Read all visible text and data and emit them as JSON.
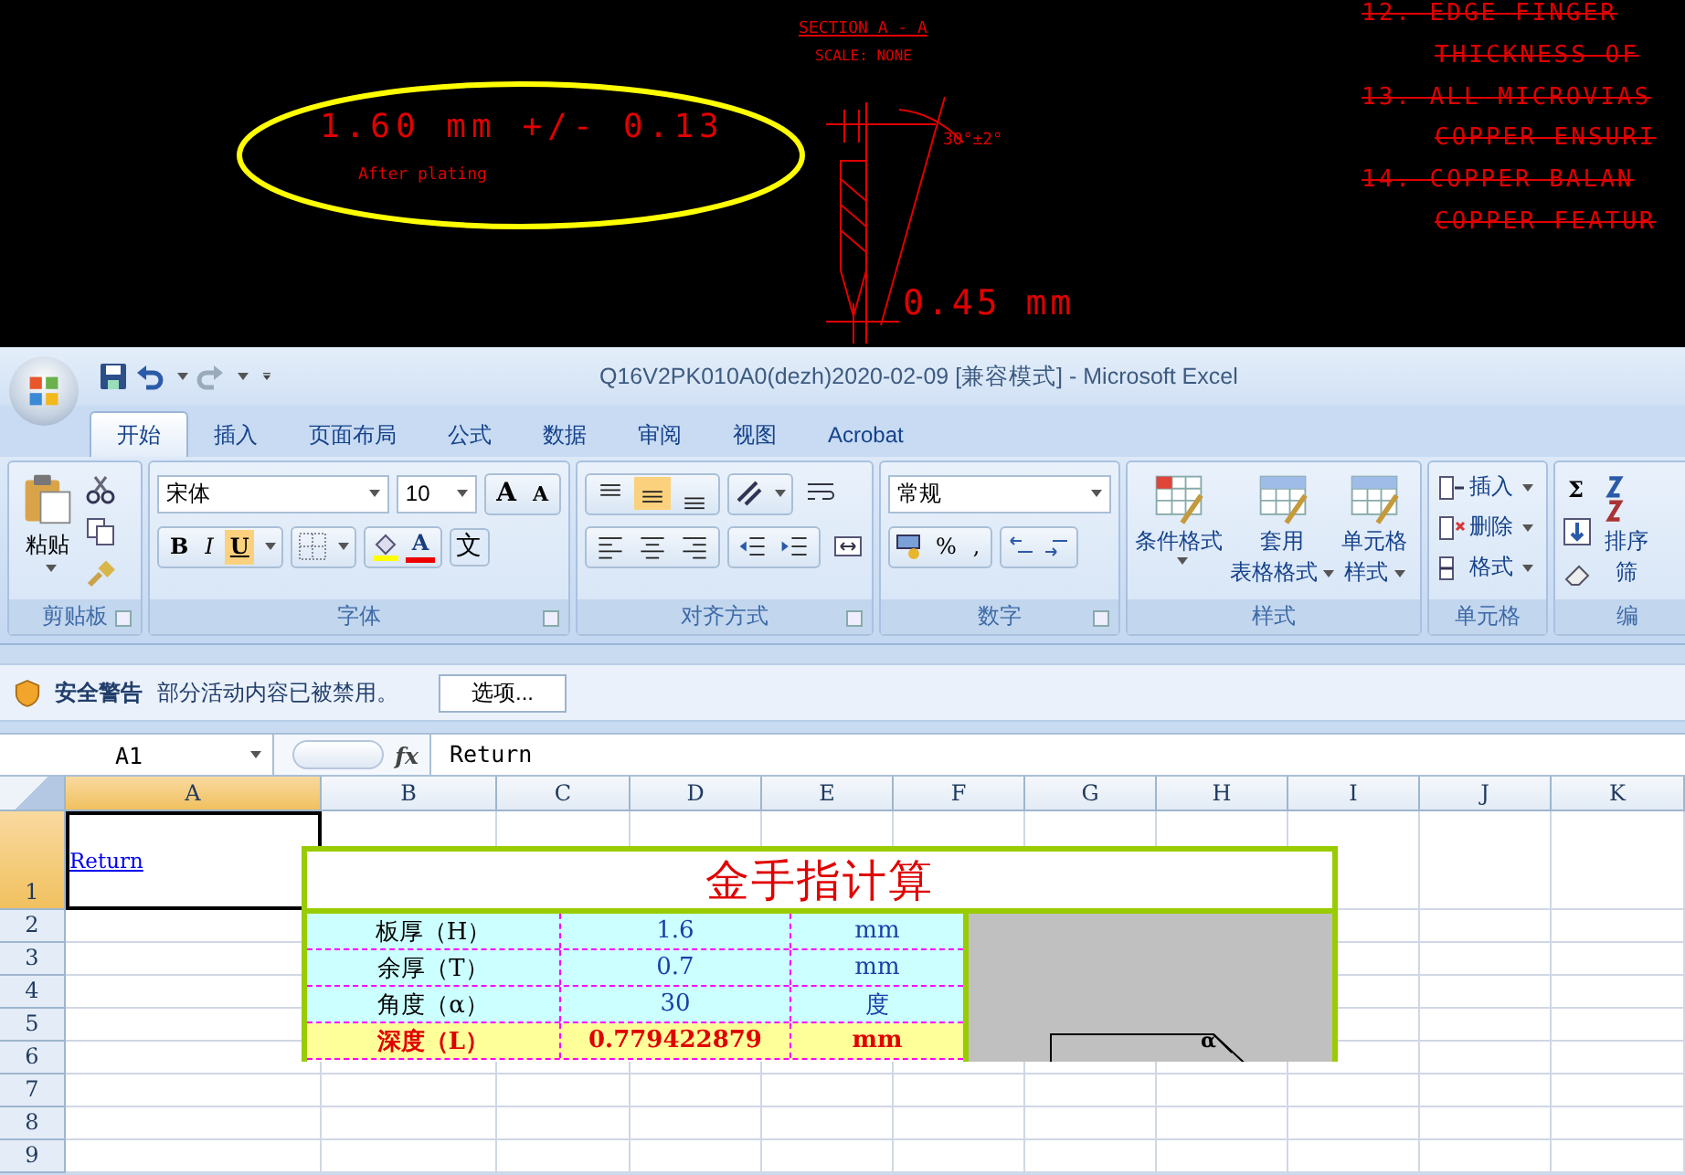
{
  "cad": {
    "section_title": "SECTION  A - A",
    "scale": "SCALE: NONE",
    "angle": "30°±2°",
    "width": "0.45 mm",
    "thickness": "1.60 mm +/- 0.13",
    "thickness_note": "After plating",
    "highlighted": true,
    "notes": [
      {
        "text": "12. EDGE FINGER",
        "kind": "item",
        "struck": true
      },
      {
        "text": "THICKNESS OF",
        "kind": "continuation",
        "struck": true
      },
      {
        "text": "13. ALL MICROVIAS",
        "kind": "item",
        "struck": true
      },
      {
        "text": "COPPER ENSURI",
        "kind": "continuation",
        "struck": true
      },
      {
        "text": "14. COPPER BALAN",
        "kind": "item",
        "struck": true
      },
      {
        "text": "COPPER FEATUR",
        "kind": "continuation",
        "struck": true
      }
    ]
  },
  "window": {
    "title": "Q16V2PK010A0(dezh)2020-02-09  [兼容模式] - Microsoft Excel"
  },
  "tabs": [
    {
      "label": "开始",
      "selected": true
    },
    {
      "label": "插入",
      "selected": false
    },
    {
      "label": "页面布局",
      "selected": false
    },
    {
      "label": "公式",
      "selected": false
    },
    {
      "label": "数据",
      "selected": false
    },
    {
      "label": "审阅",
      "selected": false
    },
    {
      "label": "视图",
      "selected": false
    },
    {
      "label": "Acrobat",
      "selected": false
    }
  ],
  "ribbon": {
    "clipboard": {
      "label": "剪贴板",
      "paste": "粘贴"
    },
    "font": {
      "label": "字体",
      "font_name": "宋体",
      "font_size": "10",
      "grow": "A",
      "shrink": "A",
      "font_color": "A",
      "phonetic": "文",
      "styles": [
        {
          "glyph": "B",
          "on": false
        },
        {
          "glyph": "I",
          "on": false
        },
        {
          "glyph": "U",
          "on": true
        }
      ]
    },
    "alignment": {
      "label": "对齐方式",
      "vertical": [
        {
          "selected": false
        },
        {
          "selected": true
        },
        {
          "selected": false
        }
      ]
    },
    "number": {
      "label": "数字",
      "format": "常规",
      "percent": "%",
      "comma": ","
    },
    "styles": {
      "label": "样式",
      "buttons": [
        [
          "条件格式"
        ],
        [
          "套用",
          "表格格式"
        ],
        [
          "单元格",
          "样式"
        ]
      ]
    },
    "cells": {
      "label": "单元格",
      "buttons": [
        "插入",
        "删除",
        "格式"
      ]
    },
    "editing": {
      "label": "编",
      "sum": "Σ",
      "sort_lines": [
        "排序",
        "筛"
      ]
    }
  },
  "security_bar": {
    "title": "安全警告",
    "message": "部分活动内容已被禁用。",
    "button": "选项..."
  },
  "formula_bar": {
    "name_box": "A1",
    "function_label": "fx",
    "value": "Return"
  },
  "sheet": {
    "columns": [
      {
        "label": "A",
        "selected": true
      },
      {
        "label": "B",
        "selected": false
      },
      {
        "label": "C",
        "selected": false
      },
      {
        "label": "D",
        "selected": false
      },
      {
        "label": "E",
        "selected": false
      },
      {
        "label": "F",
        "selected": false
      },
      {
        "label": "G",
        "selected": false
      },
      {
        "label": "H",
        "selected": false
      },
      {
        "label": "I",
        "selected": false
      },
      {
        "label": "J",
        "selected": false
      },
      {
        "label": "K",
        "selected": false
      }
    ],
    "rows": [
      {
        "label": "1",
        "selected": true
      },
      {
        "label": "2",
        "selected": false
      },
      {
        "label": "3",
        "selected": false
      },
      {
        "label": "4",
        "selected": false
      },
      {
        "label": "5",
        "selected": false
      },
      {
        "label": "6",
        "selected": false
      },
      {
        "label": "7",
        "selected": false
      },
      {
        "label": "8",
        "selected": false
      },
      {
        "label": "9",
        "selected": false
      }
    ],
    "a1_link": "Return"
  },
  "calc": {
    "title": "金手指计算",
    "angle_symbol": "α",
    "rows": [
      {
        "label": "板厚（H）",
        "value": "1.6",
        "unit": "mm",
        "highlight": false
      },
      {
        "label": "余厚（T）",
        "value": "0.7",
        "unit": "mm",
        "highlight": false
      },
      {
        "label": "角度（α）",
        "value": "30",
        "unit": "度",
        "highlight": false
      },
      {
        "label": "深度（L）",
        "value": "0.779422879",
        "unit": "mm",
        "highlight": true
      }
    ]
  }
}
